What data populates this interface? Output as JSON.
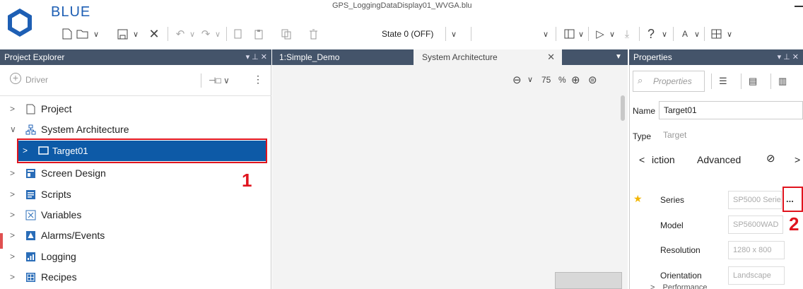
{
  "app": {
    "name": "BLUE",
    "window_title": "GPS_LoggingDataDisplay01_WVGA.blu",
    "brand_color": "#1e5fb4"
  },
  "toolbar": {
    "state_label": "State 0 (OFF)"
  },
  "explorer": {
    "title": "Project Explorer",
    "driver_label": "Driver",
    "items": [
      {
        "label": "Project",
        "icon": "page-icon"
      },
      {
        "label": "System Architecture",
        "icon": "architecture-icon"
      },
      {
        "label": "Target01",
        "icon": "screen-icon"
      },
      {
        "label": "Screen Design",
        "icon": "screen-design-icon"
      },
      {
        "label": "Scripts",
        "icon": "scripts-icon"
      },
      {
        "label": "Variables",
        "icon": "variables-icon"
      },
      {
        "label": "Alarms/Events",
        "icon": "alarms-icon"
      },
      {
        "label": "Logging",
        "icon": "logging-icon"
      },
      {
        "label": "Recipes",
        "icon": "recipes-icon"
      }
    ]
  },
  "editor": {
    "tabs": [
      {
        "label": "1:Simple_Demo"
      },
      {
        "label": "System Architecture"
      }
    ],
    "zoom_value": "75",
    "zoom_unit": "%"
  },
  "properties": {
    "title": "Properties",
    "search_placeholder": "Properties",
    "name_label": "Name",
    "name_value": "Target01",
    "type_label": "Type",
    "type_value": "Target",
    "tabs": [
      "iction",
      "Advanced"
    ],
    "rows": [
      {
        "label": "Series",
        "value": "SP5000 Serie"
      },
      {
        "label": "Model",
        "value": "SP5600WAD"
      },
      {
        "label": "Resolution",
        "value": "1280 x 800"
      },
      {
        "label": "Orientation",
        "value": "Landscape"
      }
    ],
    "more_button": "...",
    "partial_row": "Performance"
  },
  "callouts": {
    "one": "1",
    "two": "2",
    "color": "#e0141e"
  }
}
